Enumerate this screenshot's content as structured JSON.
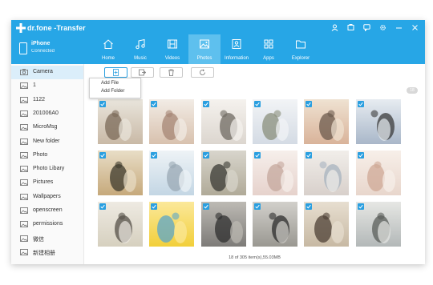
{
  "app": {
    "brand": "dr.fone -Transfer"
  },
  "device": {
    "name": "iPhone",
    "status": "Connected"
  },
  "nav": {
    "tabs": [
      {
        "label": "Home",
        "icon": "home-icon"
      },
      {
        "label": "Music",
        "icon": "music-icon"
      },
      {
        "label": "Videos",
        "icon": "videos-icon"
      },
      {
        "label": "Photos",
        "icon": "photos-icon"
      },
      {
        "label": "Information",
        "icon": "information-icon"
      },
      {
        "label": "Apps",
        "icon": "apps-icon"
      },
      {
        "label": "Explorer",
        "icon": "explorer-icon"
      }
    ]
  },
  "sidebar": {
    "items": [
      {
        "label": "Camera",
        "icon": "camera-icon"
      },
      {
        "label": "1",
        "icon": "folder-icon"
      },
      {
        "label": "1122",
        "icon": "folder-icon"
      },
      {
        "label": "201006A0",
        "icon": "folder-icon"
      },
      {
        "label": "MicroMsg",
        "icon": "folder-icon"
      },
      {
        "label": "New folder",
        "icon": "folder-icon"
      },
      {
        "label": "Photo",
        "icon": "folder-icon"
      },
      {
        "label": "Photo Libary",
        "icon": "folder-icon"
      },
      {
        "label": "Pictures",
        "icon": "folder-icon"
      },
      {
        "label": "Wallpapers",
        "icon": "folder-icon"
      },
      {
        "label": "openscreen",
        "icon": "folder-icon"
      },
      {
        "label": "permissions",
        "icon": "folder-icon"
      },
      {
        "label": "微信",
        "icon": "folder-icon"
      },
      {
        "label": "新建相册",
        "icon": "folder-icon"
      }
    ]
  },
  "toolbar": {
    "buttons": [
      {
        "icon": "add-icon"
      },
      {
        "icon": "export-icon"
      },
      {
        "icon": "trash-icon"
      },
      {
        "icon": "refresh-icon"
      }
    ]
  },
  "add_menu": {
    "add_file": "Add File",
    "add_folder": "Add Folder"
  },
  "group": {
    "count": "18"
  },
  "photos": [
    {
      "colors": [
        "#c9b9a6",
        "#7b6a58",
        "#e9e5dc"
      ]
    },
    {
      "colors": [
        "#d8c1ae",
        "#a58574",
        "#f2ece6"
      ]
    },
    {
      "colors": [
        "#dcd6cf",
        "#6f6a62",
        "#f5f2ee"
      ]
    },
    {
      "colors": [
        "#d4dbe4",
        "#8a8f7c",
        "#f2f4f6"
      ]
    },
    {
      "colors": [
        "#d9b39a",
        "#6c5a4c",
        "#efe2d2"
      ]
    },
    {
      "colors": [
        "#a9b7c9",
        "#3b3b3b",
        "#e7ecf1"
      ]
    },
    {
      "colors": [
        "#c6a97b",
        "#3e3a2c",
        "#e8ddc6"
      ]
    },
    {
      "colors": [
        "#c3d6e4",
        "#9aa8b4",
        "#eef3f6"
      ]
    },
    {
      "colors": [
        "#b0aa98",
        "#3a3a34",
        "#d8d5cc"
      ]
    },
    {
      "colors": [
        "#e6d2cc",
        "#c4a79c",
        "#f6efeb"
      ]
    },
    {
      "colors": [
        "#d8d0cb",
        "#a7b3bf",
        "#f1eeea"
      ]
    },
    {
      "colors": [
        "#e8d6cc",
        "#cfa896",
        "#f7efe9"
      ]
    },
    {
      "colors": [
        "#d6d0bf",
        "#555048",
        "#eeeae2"
      ]
    },
    {
      "colors": [
        "#f2cf3a",
        "#5ba6c9",
        "#fbe89a"
      ]
    },
    {
      "colors": [
        "#7d7b78",
        "#2f2f2f",
        "#bdbab4"
      ]
    },
    {
      "colors": [
        "#9a9891",
        "#2c2c2c",
        "#d2d0cb"
      ]
    },
    {
      "colors": [
        "#c7b9a3",
        "#4d4035",
        "#e7ded0"
      ]
    },
    {
      "colors": [
        "#b3b8b8",
        "#5a5e5a",
        "#e6e7e4"
      ]
    }
  ],
  "status_bar": {
    "text": "18 of 305 item(s),55.03MB"
  },
  "colors": {
    "accent": "#27a6e6",
    "active_tab": "#5ec0ee",
    "check": "#2a9fe0"
  }
}
